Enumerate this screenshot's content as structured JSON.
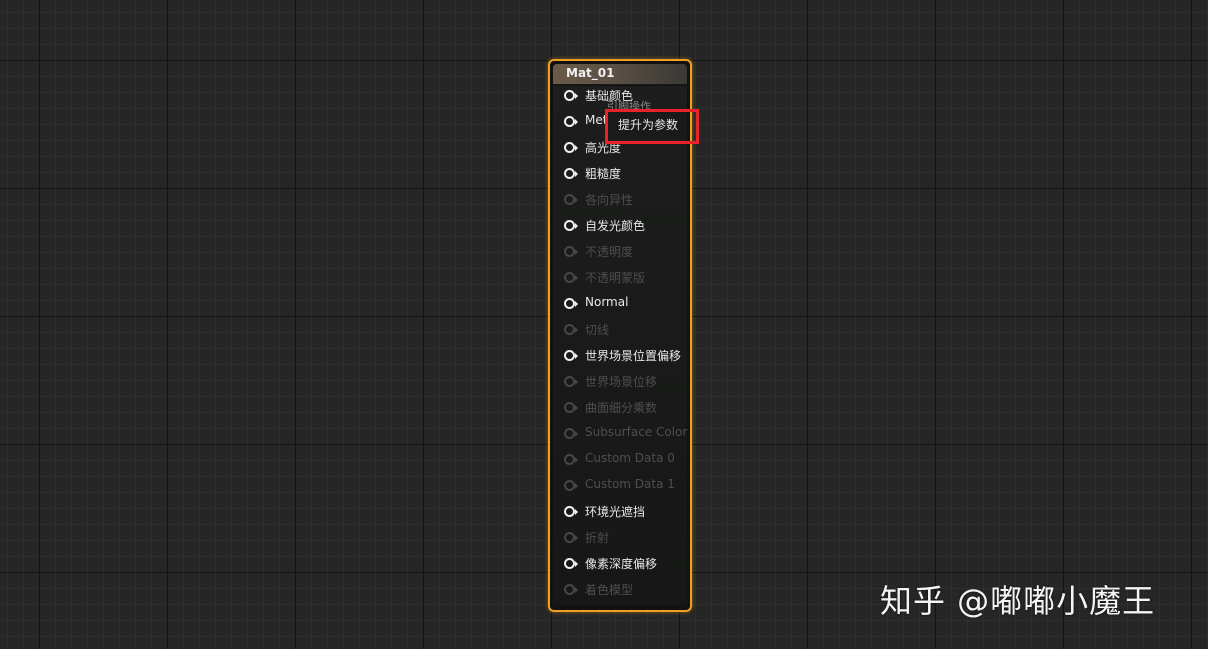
{
  "node": {
    "title": "Mat_01",
    "pins": [
      {
        "label": "基础颜色",
        "enabled": true
      },
      {
        "label": "Met",
        "enabled": true
      },
      {
        "label": "高光度",
        "enabled": true
      },
      {
        "label": "粗糙度",
        "enabled": true
      },
      {
        "label": "各向异性",
        "enabled": false
      },
      {
        "label": "自发光颜色",
        "enabled": true
      },
      {
        "label": "不透明度",
        "enabled": false
      },
      {
        "label": "不透明蒙版",
        "enabled": false
      },
      {
        "label": "Normal",
        "enabled": true
      },
      {
        "label": "切线",
        "enabled": false
      },
      {
        "label": "世界场景位置偏移",
        "enabled": true
      },
      {
        "label": "世界场景位移",
        "enabled": false
      },
      {
        "label": "曲面细分乘数",
        "enabled": false
      },
      {
        "label": "Subsurface Color",
        "enabled": false
      },
      {
        "label": "Custom Data 0",
        "enabled": false
      },
      {
        "label": "Custom Data 1",
        "enabled": false
      },
      {
        "label": "环境光遮挡",
        "enabled": true
      },
      {
        "label": "折射",
        "enabled": false
      },
      {
        "label": "像素深度偏移",
        "enabled": true
      },
      {
        "label": "着色模型",
        "enabled": false
      }
    ]
  },
  "context_menu": {
    "header": "引脚操作",
    "items": [
      {
        "label": "提升为参数"
      }
    ]
  },
  "watermark": {
    "text": "知乎 @嘟嘟小魔王"
  },
  "colors": {
    "node_border": "#f0a020",
    "highlight": "#e8242a",
    "background": "#262626"
  }
}
